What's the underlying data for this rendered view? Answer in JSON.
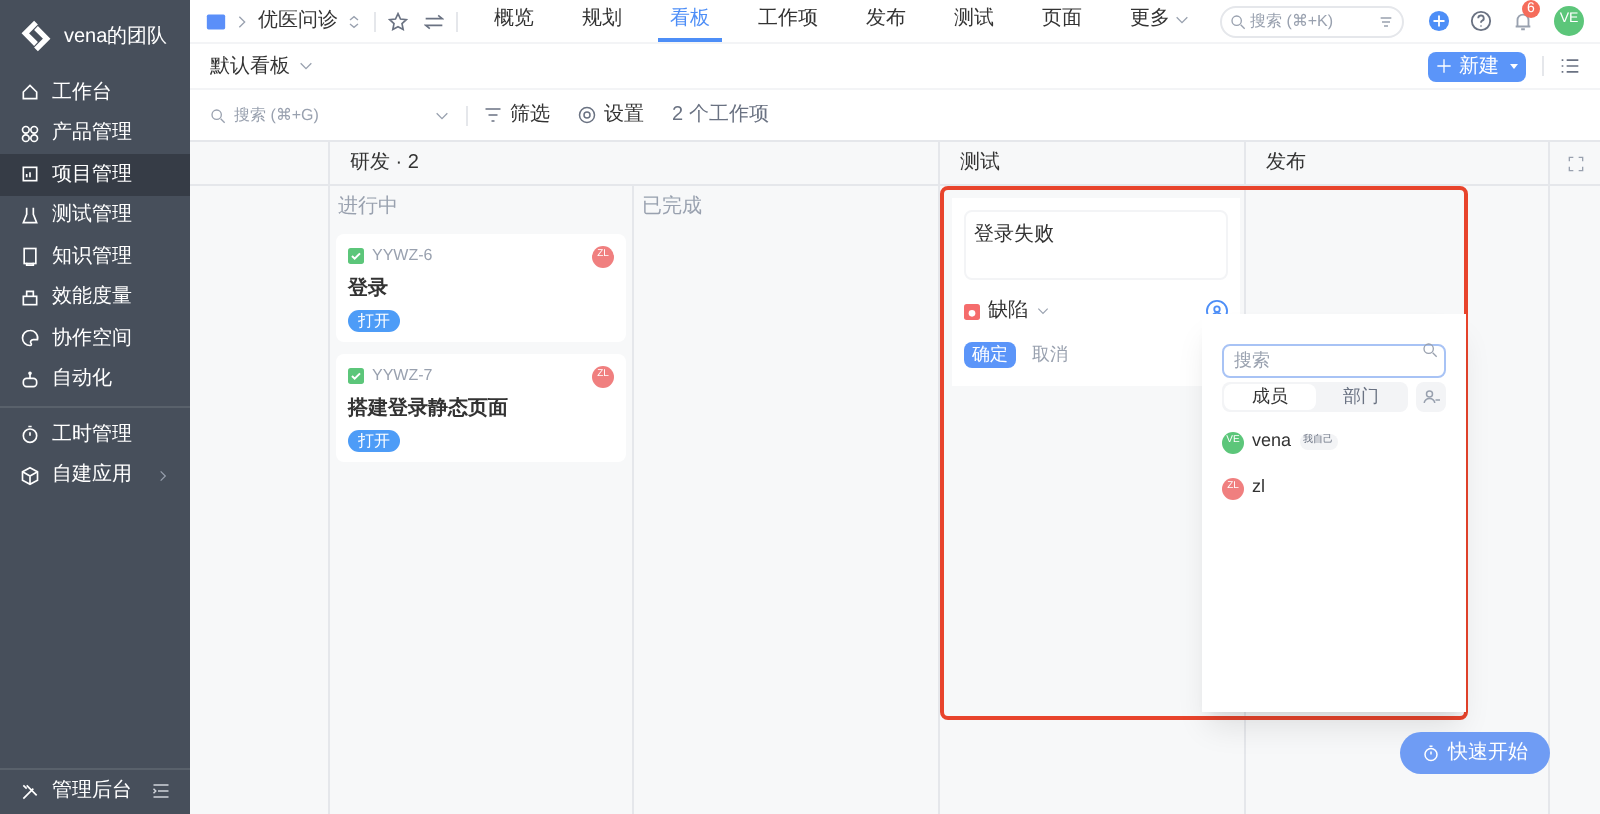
{
  "sidebar": {
    "team": "vena的团队",
    "items": [
      {
        "label": "工作台",
        "selected": false
      },
      {
        "label": "产品管理",
        "selected": false
      },
      {
        "label": "项目管理",
        "selected": true
      },
      {
        "label": "测试管理",
        "selected": false
      },
      {
        "label": "知识管理",
        "selected": false
      },
      {
        "label": "效能度量",
        "selected": false
      },
      {
        "label": "协作空间",
        "selected": false
      },
      {
        "label": "自动化",
        "selected": false,
        "divider_after": true
      },
      {
        "label": "工时管理",
        "selected": false
      },
      {
        "label": "自建应用",
        "selected": false,
        "has_submenu": true
      }
    ],
    "footer": "管理后台"
  },
  "topbar": {
    "project": "优医问诊",
    "tabs": [
      {
        "label": "概览",
        "selected": false
      },
      {
        "label": "规划",
        "selected": false
      },
      {
        "label": "看板",
        "selected": true
      },
      {
        "label": "工作项",
        "selected": false
      },
      {
        "label": "发布",
        "selected": false
      },
      {
        "label": "测试",
        "selected": false
      },
      {
        "label": "页面",
        "selected": false
      },
      {
        "label": "更多",
        "selected": false,
        "dropdown": true
      }
    ],
    "search": {
      "placeholder": "搜索 (⌘+K)"
    },
    "notification_count": "6",
    "user_avatar": "VE"
  },
  "toolbar": {
    "view": "默认看板",
    "new_button": "新建"
  },
  "filter_bar": {
    "search": {
      "placeholder": "搜索 (⌘+G)"
    },
    "filter": "筛选",
    "settings": "设置",
    "count": "2 个工作项"
  },
  "board": {
    "columns": [
      {
        "title": "研发 · 2",
        "subcolumns": [
          {
            "title": "进行中",
            "cards": [
              {
                "id": "YYWZ-6",
                "title": "登录",
                "status": "打开",
                "assignee": "ZL",
                "color": "#f07f7f"
              },
              {
                "id": "YYWZ-7",
                "title": "搭建登录静态页面",
                "status": "打开",
                "assignee": "ZL",
                "color": "#f07f7f"
              }
            ]
          },
          {
            "title": "已完成"
          }
        ]
      },
      {
        "title": "测试"
      },
      {
        "title": "发布"
      }
    ],
    "new_card": {
      "value": "登录失败",
      "type": "缺陷",
      "confirm": "确定",
      "cancel": "取消"
    },
    "assignee_popup": {
      "search": {
        "placeholder": "搜索"
      },
      "tabs": [
        {
          "label": "成员",
          "selected": true
        },
        {
          "label": "部门",
          "selected": false
        }
      ],
      "members": [
        {
          "avatar": "VE",
          "name": "vena",
          "tag": "我自己",
          "color": "#5cc67a"
        },
        {
          "avatar": "ZL",
          "name": "zl",
          "color": "#f07f7f"
        }
      ]
    }
  },
  "quick_start": "快速开始"
}
